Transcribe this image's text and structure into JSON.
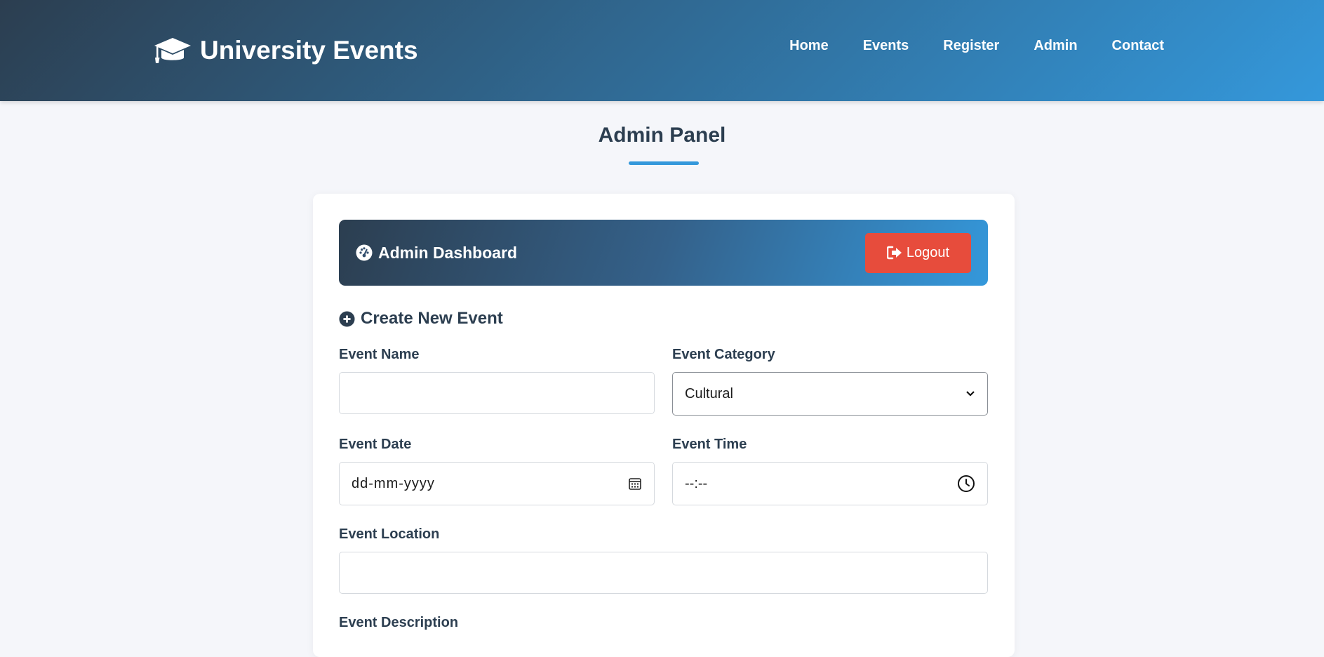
{
  "header": {
    "brand": "University Events",
    "nav": [
      "Home",
      "Events",
      "Register",
      "Admin",
      "Contact"
    ]
  },
  "page_title": "Admin Panel",
  "dashboard": {
    "title": "Admin Dashboard",
    "logout_label": "Logout"
  },
  "form": {
    "section_title": "Create New Event",
    "event_name": {
      "label": "Event Name",
      "value": ""
    },
    "event_category": {
      "label": "Event Category",
      "selected": "Cultural"
    },
    "event_date": {
      "label": "Event Date",
      "placeholder": "dd-mm-yyyy"
    },
    "event_time": {
      "label": "Event Time",
      "placeholder": "--:--"
    },
    "event_location": {
      "label": "Event Location",
      "value": ""
    },
    "event_description": {
      "label": "Event Description"
    }
  },
  "colors": {
    "primary_dark": "#2c3e50",
    "accent": "#3498db",
    "danger": "#e74c3c",
    "background": "#f5f6fa"
  },
  "icons": {
    "brand": "graduation-cap-icon",
    "dashboard": "tachometer-icon",
    "logout": "sign-out-icon",
    "section": "plus-circle-icon",
    "date": "calendar-icon",
    "time": "clock-icon",
    "select": "chevron-down-icon"
  }
}
